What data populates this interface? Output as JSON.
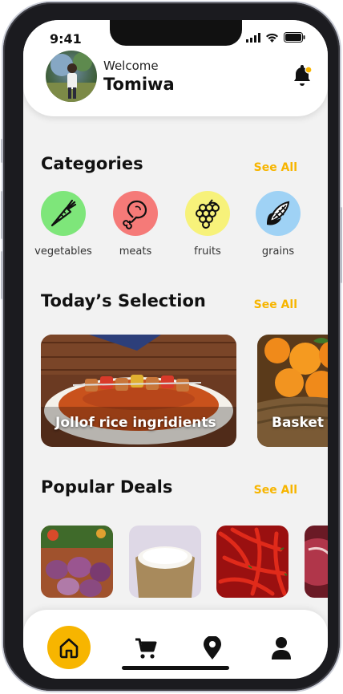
{
  "status_bar": {
    "time": "9:41"
  },
  "header": {
    "welcome": "Welcome",
    "username": "Tomiwa"
  },
  "categories": {
    "title": "Categories",
    "see_all": "See All",
    "items": [
      {
        "label": "vegetables",
        "color": "#7ee67a",
        "icon": "carrot-icon"
      },
      {
        "label": "meats",
        "color": "#f57a78",
        "icon": "meat-leg-icon"
      },
      {
        "label": "fruits",
        "color": "#f7f27a",
        "icon": "grapes-icon"
      },
      {
        "label": "grains",
        "color": "#9fd2f5",
        "icon": "corn-icon"
      }
    ]
  },
  "todays_selection": {
    "title": "Today’s Selection",
    "see_all": "See All",
    "items": [
      {
        "label": "Jollof rice ingridients"
      },
      {
        "label": "Basket"
      }
    ]
  },
  "popular_deals": {
    "title": "Popular Deals",
    "see_all": "See All",
    "items": [
      "onions-photo",
      "rice-sack-photo",
      "red-peppers-photo",
      "meat-photo"
    ]
  },
  "bottom_nav": {
    "items": [
      "home-icon",
      "cart-icon",
      "location-pin-icon",
      "profile-icon"
    ],
    "active": "home-icon"
  },
  "colors": {
    "accent": "#f7b500",
    "background": "#f2f2f2"
  }
}
